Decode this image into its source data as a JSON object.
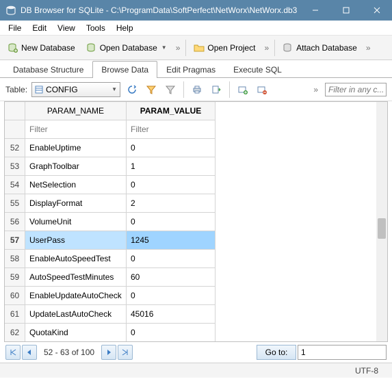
{
  "window": {
    "title": "DB Browser for SQLite - C:\\ProgramData\\SoftPerfect\\NetWorx\\NetWorx.db3"
  },
  "menu": {
    "items": [
      "File",
      "Edit",
      "View",
      "Tools",
      "Help"
    ]
  },
  "toolbar": {
    "new_db": "New Database",
    "open_db": "Open Database",
    "open_project": "Open Project",
    "attach_db": "Attach Database"
  },
  "tabs": {
    "items": [
      "Database Structure",
      "Browse Data",
      "Edit Pragmas",
      "Execute SQL"
    ],
    "active_index": 1
  },
  "browse": {
    "table_label": "Table:",
    "selected_table": "CONFIG",
    "filter_any_placeholder": "Filter in any c..."
  },
  "grid": {
    "columns": [
      "PARAM_NAME",
      "PARAM_VALUE"
    ],
    "filter_placeholder": "Filter",
    "selected_row": 57,
    "rows": [
      {
        "n": 52,
        "name": "EnableUptime",
        "value": "0"
      },
      {
        "n": 53,
        "name": "GraphToolbar",
        "value": "1"
      },
      {
        "n": 54,
        "name": "NetSelection",
        "value": "0"
      },
      {
        "n": 55,
        "name": "DisplayFormat",
        "value": "2"
      },
      {
        "n": 56,
        "name": "VolumeUnit",
        "value": "0"
      },
      {
        "n": 57,
        "name": "UserPass",
        "value": "1245"
      },
      {
        "n": 58,
        "name": "EnableAutoSpeedTest",
        "value": "0"
      },
      {
        "n": 59,
        "name": "AutoSpeedTestMinutes",
        "value": "60"
      },
      {
        "n": 60,
        "name": "EnableUpdateAutoCheck",
        "value": "0"
      },
      {
        "n": 61,
        "name": "UpdateLastAutoCheck",
        "value": "45016"
      },
      {
        "n": 62,
        "name": "QuotaKind",
        "value": "0"
      }
    ]
  },
  "pager": {
    "range": "52 - 63 of 100",
    "goto_label": "Go to:",
    "goto_value": "1"
  },
  "status": {
    "encoding": "UTF-8"
  }
}
